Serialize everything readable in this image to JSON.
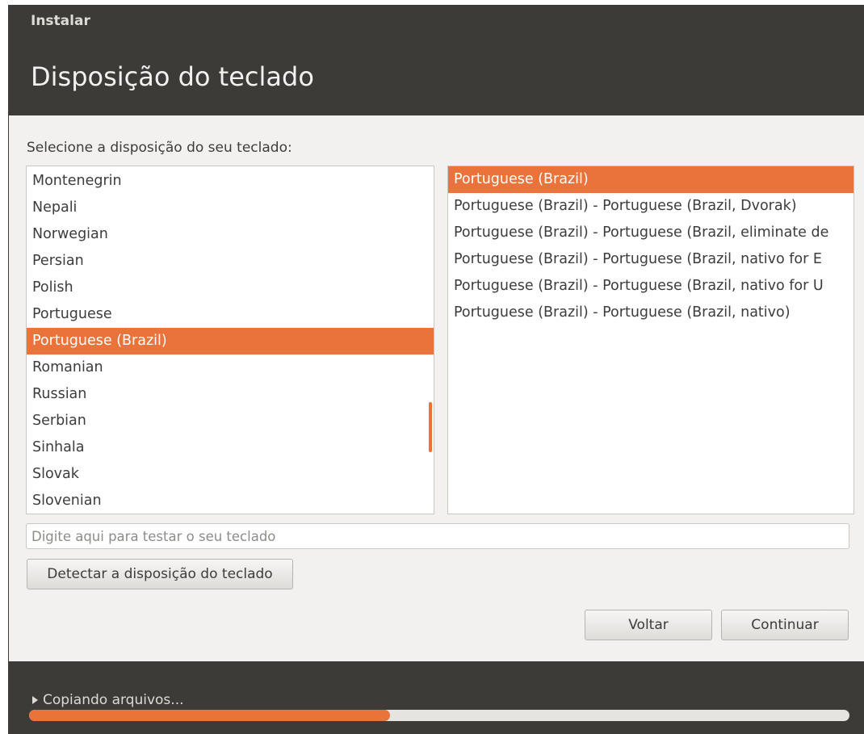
{
  "window": {
    "app_title": "Instalar",
    "page_title": "Disposição do teclado"
  },
  "prompt": "Selecione a disposição do seu teclado:",
  "layouts": {
    "items": [
      {
        "label": "Montenegrin",
        "selected": false
      },
      {
        "label": "Nepali",
        "selected": false
      },
      {
        "label": "Norwegian",
        "selected": false
      },
      {
        "label": "Persian",
        "selected": false
      },
      {
        "label": "Polish",
        "selected": false
      },
      {
        "label": "Portuguese",
        "selected": false
      },
      {
        "label": "Portuguese (Brazil)",
        "selected": true
      },
      {
        "label": "Romanian",
        "selected": false
      },
      {
        "label": "Russian",
        "selected": false
      },
      {
        "label": "Serbian",
        "selected": false
      },
      {
        "label": "Sinhala",
        "selected": false
      },
      {
        "label": "Slovak",
        "selected": false
      },
      {
        "label": "Slovenian",
        "selected": false
      }
    ]
  },
  "variants": {
    "items": [
      {
        "label": "Portuguese (Brazil)",
        "selected": true
      },
      {
        "label": "Portuguese (Brazil) - Portuguese (Brazil, Dvorak)",
        "selected": false
      },
      {
        "label": "Portuguese (Brazil) - Portuguese (Brazil, eliminate de",
        "selected": false
      },
      {
        "label": "Portuguese (Brazil) - Portuguese (Brazil, nativo for E",
        "selected": false
      },
      {
        "label": "Portuguese (Brazil) - Portuguese (Brazil, nativo for U",
        "selected": false
      },
      {
        "label": "Portuguese (Brazil) - Portuguese (Brazil, nativo)",
        "selected": false
      }
    ]
  },
  "test_field": {
    "placeholder": "Digite aqui para testar o seu teclado",
    "value": ""
  },
  "buttons": {
    "detect": "Detectar a disposição do teclado",
    "back": "Voltar",
    "continue": "Continuar"
  },
  "progress": {
    "label": "Copiando arquivos...",
    "fraction": 0.44,
    "icon": "triangle-right-icon"
  },
  "colors": {
    "accent": "#e9733a",
    "header_bg": "#3c3b37",
    "content_bg": "#f2f1f0"
  }
}
